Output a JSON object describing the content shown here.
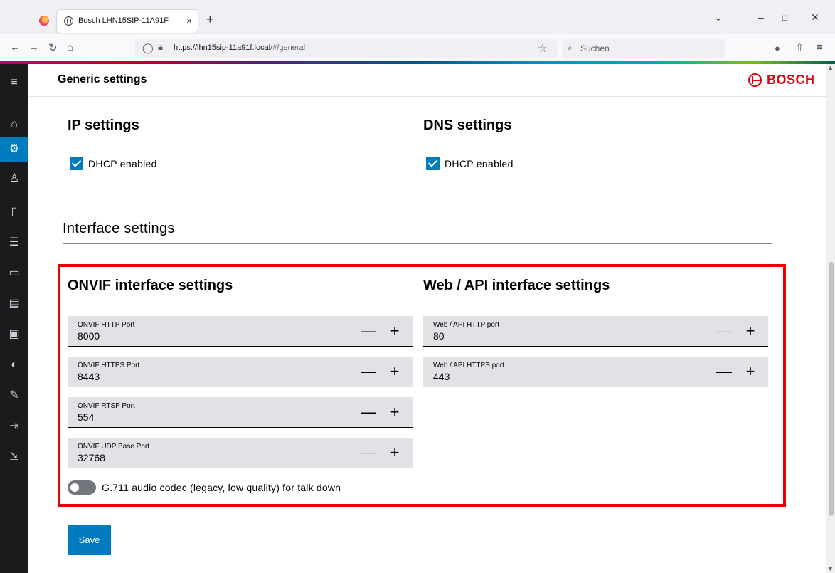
{
  "browser": {
    "tab_title": "Bosch LHN15SIP-11A91F",
    "tab_close": "×",
    "new_tab": "+",
    "url_host": "https://lhn15sip-11a91f.local",
    "url_path": "/#/general",
    "search_placeholder": "Suchen",
    "icons": [
      "firefox-logo",
      "back-icon",
      "forward-icon",
      "reload-icon",
      "home-icon",
      "shield-icon",
      "lock-icon",
      "star-icon",
      "search-icon",
      "account-icon",
      "extensions-icon",
      "menu-icon"
    ]
  },
  "sidebar": {
    "items": [
      {
        "icon": "hamburger-menu-icon",
        "glyph": "≡"
      },
      {
        "icon": "home-icon",
        "glyph": "⌂"
      },
      {
        "icon": "settings-gear-icon",
        "glyph": "⚙",
        "active": true
      },
      {
        "icon": "user-icon",
        "glyph": "♙"
      },
      {
        "icon": "device-icon",
        "glyph": "▯"
      },
      {
        "icon": "sliders-icon",
        "glyph": "☰"
      },
      {
        "icon": "message-icon",
        "glyph": "▭"
      },
      {
        "icon": "calendar-icon",
        "glyph": "▤"
      },
      {
        "icon": "monitor-icon",
        "glyph": "▣"
      },
      {
        "icon": "shield-icon",
        "glyph": "◐"
      },
      {
        "icon": "wrench-icon",
        "glyph": "✎"
      },
      {
        "icon": "list-indent-icon",
        "glyph": "⇥"
      },
      {
        "icon": "logout-icon",
        "glyph": "⇲"
      }
    ]
  },
  "header": {
    "title": "Generic settings",
    "brand": "BOSCH"
  },
  "ip_settings": {
    "title": "IP settings",
    "dhcp_label": "DHCP enabled",
    "dhcp_checked": true
  },
  "dns_settings": {
    "title": "DNS settings",
    "dhcp_label": "DHCP enabled",
    "dhcp_checked": true
  },
  "interface": {
    "title": "Interface settings"
  },
  "onvif": {
    "title": "ONVIF interface settings",
    "fields": [
      {
        "label": "ONVIF HTTP Port",
        "value": "8000"
      },
      {
        "label": "ONVIF HTTPS Port",
        "value": "8443"
      },
      {
        "label": "ONVIF RTSP Port",
        "value": "554"
      },
      {
        "label": "ONVIF UDP Base Port",
        "value": "32768"
      }
    ],
    "codec_toggle_label": "G.711 audio codec (legacy, low quality) for talk down",
    "codec_toggle_on": false
  },
  "web_api": {
    "title": "Web / API interface settings",
    "fields": [
      {
        "label": "Web / API HTTP port",
        "value": "80"
      },
      {
        "label": "Web / API HTTPS port",
        "value": "443"
      }
    ]
  },
  "stepper": {
    "minus": "—",
    "plus": "+"
  },
  "actions": {
    "save_label": "Save"
  },
  "colors": {
    "accent_blue": "#007bc0",
    "highlight_red": "#e60000",
    "bosch_red": "#e20015"
  }
}
